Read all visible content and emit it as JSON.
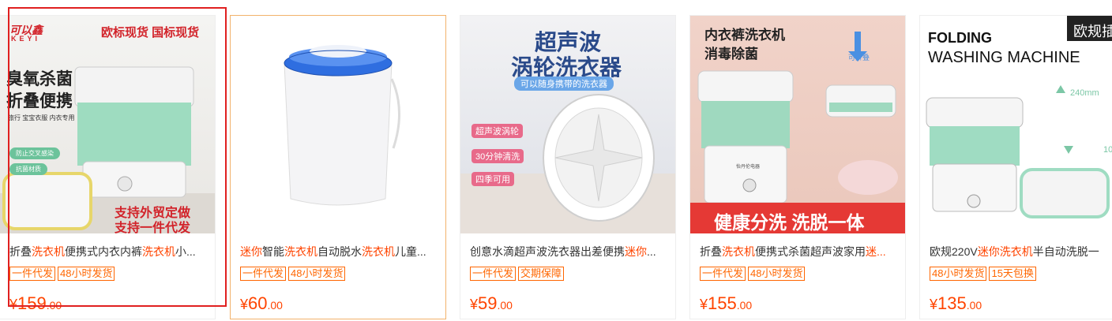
{
  "products": [
    {
      "title_parts": [
        {
          "t": "折叠",
          "hl": false
        },
        {
          "t": "洗衣机",
          "hl": true
        },
        {
          "t": "便携式内衣内裤",
          "hl": false
        },
        {
          "t": "洗衣机",
          "hl": true
        },
        {
          "t": "小...",
          "hl": false
        }
      ],
      "tags": [
        "一件代发",
        "48小时发货"
      ],
      "price": {
        "currency": "¥",
        "int": "159",
        "dec": ".00"
      },
      "image_text": {
        "brand": "可以鑫",
        "brand_sub": "KEYI",
        "top": "欧标现货 国标现货",
        "line1": "臭氧杀菌",
        "line2": "折叠便携",
        "line3": "旅行 宝宝衣服 内衣专用",
        "badge1": "防止交叉感染",
        "badge2": "抗菌材质",
        "bottom1": "支持外贸定做",
        "bottom2": "支持一件代发"
      }
    },
    {
      "title_parts": [
        {
          "t": "迷你",
          "hl": true
        },
        {
          "t": "智能",
          "hl": false
        },
        {
          "t": "洗衣机",
          "hl": true
        },
        {
          "t": "自动脱水",
          "hl": false
        },
        {
          "t": "洗衣机",
          "hl": true
        },
        {
          "t": "儿童...",
          "hl": false
        }
      ],
      "tags": [
        "一件代发",
        "48小时发货"
      ],
      "price": {
        "currency": "¥",
        "int": "60",
        "dec": ".00"
      }
    },
    {
      "title_parts": [
        {
          "t": "创意水滴超声波洗衣器出差便携",
          "hl": false
        },
        {
          "t": "迷你",
          "hl": true
        },
        {
          "t": "...",
          "hl": false
        }
      ],
      "tags": [
        "一件代发",
        "交期保障"
      ],
      "price": {
        "currency": "¥",
        "int": "59",
        "dec": ".00"
      },
      "image_text": {
        "headline1": "超声波",
        "headline2": "涡轮洗衣器",
        "sub": "可以随身携带的洗衣器",
        "chip1": "超声波涡轮",
        "chip2": "30分钟清洗",
        "chip3": "四季可用"
      }
    },
    {
      "title_parts": [
        {
          "t": "折叠",
          "hl": false
        },
        {
          "t": "洗衣机",
          "hl": true
        },
        {
          "t": "便携式杀菌超声波家用",
          "hl": false
        },
        {
          "t": "迷...",
          "hl": true
        }
      ],
      "tags": [
        "一件代发",
        "48小时发货"
      ],
      "price": {
        "currency": "¥",
        "int": "155",
        "dec": ".00"
      },
      "image_text": {
        "line1": "内衣裤洗衣机",
        "line2": "消毒除菌",
        "fold": "可折叠",
        "brand": "怡丹伦电器",
        "bottom": "健康分洗 洗脱一体"
      }
    },
    {
      "title_parts": [
        {
          "t": "欧规220V",
          "hl": false
        },
        {
          "t": "迷你",
          "hl": true
        },
        {
          "t": "洗衣机",
          "hl": true
        },
        {
          "t": "半自动洗脱一",
          "hl": false
        }
      ],
      "tags": [
        "48小时发货",
        "15天包换"
      ],
      "price": {
        "currency": "¥",
        "int": "135",
        "dec": ".00"
      },
      "image_text": {
        "line1": "FOLDING",
        "line2": "WASHING MACHINE",
        "corner": "欧规插",
        "dim1": "240mm",
        "dim2": "10"
      }
    }
  ],
  "colors": {
    "accent": "#ff4400",
    "tag": "#ff6600",
    "mint": "#8fd8b5",
    "selection": "#e02020"
  }
}
